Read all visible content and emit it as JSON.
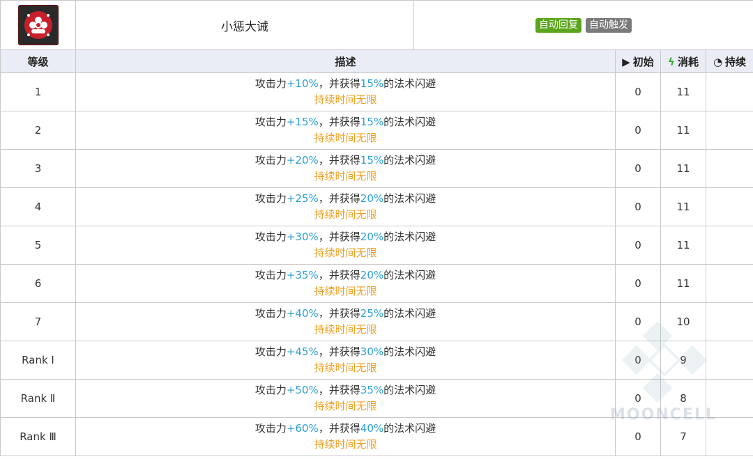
{
  "skill": {
    "icon": "skill-emblem-icon",
    "name": "小惩大诫",
    "tags": [
      "自动回复",
      "自动触发"
    ]
  },
  "columns": {
    "level": "等级",
    "description": "描述",
    "initial": "初始",
    "cost": "消耗",
    "duration": "持续"
  },
  "rows": [
    {
      "level": "1",
      "atk": "+10%",
      "dodge": "15%",
      "initial": "0",
      "cost": "11",
      "duration": ""
    },
    {
      "level": "2",
      "atk": "+15%",
      "dodge": "15%",
      "initial": "0",
      "cost": "11",
      "duration": ""
    },
    {
      "level": "3",
      "atk": "+20%",
      "dodge": "15%",
      "initial": "0",
      "cost": "11",
      "duration": ""
    },
    {
      "level": "4",
      "atk": "+25%",
      "dodge": "20%",
      "initial": "0",
      "cost": "11",
      "duration": ""
    },
    {
      "level": "5",
      "atk": "+30%",
      "dodge": "20%",
      "initial": "0",
      "cost": "11",
      "duration": ""
    },
    {
      "level": "6",
      "atk": "+35%",
      "dodge": "20%",
      "initial": "0",
      "cost": "11",
      "duration": ""
    },
    {
      "level": "7",
      "atk": "+40%",
      "dodge": "25%",
      "initial": "0",
      "cost": "10",
      "duration": ""
    },
    {
      "level": "Rank Ⅰ",
      "atk": "+45%",
      "dodge": "30%",
      "initial": "0",
      "cost": "9",
      "duration": ""
    },
    {
      "level": "Rank Ⅱ",
      "atk": "+50%",
      "dodge": "35%",
      "initial": "0",
      "cost": "8",
      "duration": ""
    },
    {
      "level": "Rank Ⅲ",
      "atk": "+60%",
      "dodge": "40%",
      "initial": "0",
      "cost": "7",
      "duration": ""
    }
  ],
  "desc_parts": {
    "prefix": "攻击力",
    "middle": "，并获得",
    "suffix": "的法术闪避",
    "line2": "持续时间无限"
  },
  "watermark_text": "MOONCELL",
  "colors": {
    "highlight": "#2aa0d8",
    "orange": "#f0a020",
    "tag_green": "#5aa51c",
    "tag_gray": "#7a7a7a",
    "header_bg": "#eaedf5"
  }
}
